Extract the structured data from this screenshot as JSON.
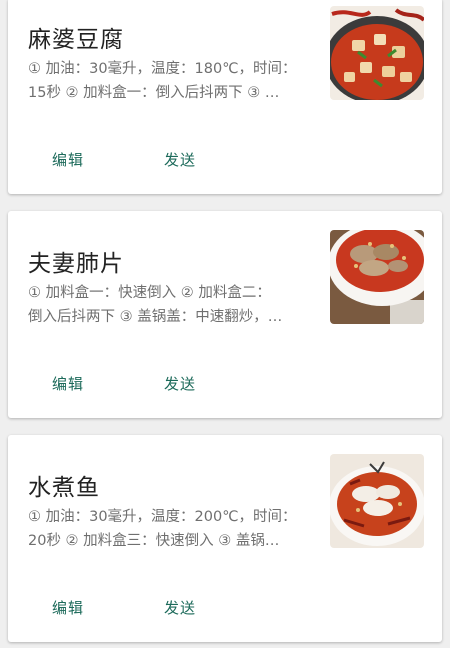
{
  "recipes": [
    {
      "title": "麻婆豆腐",
      "desc_line1": "① 加油：30毫升，温度：180℃，时间：",
      "desc_line2": "15秒 ② 加料盒一：倒入后抖两下 ③ …",
      "image": "mapo-tofu-photo",
      "edit_label": "编辑",
      "send_label": "发送"
    },
    {
      "title": "夫妻肺片",
      "desc_line1": "① 加料盒一：快速倒入 ② 加料盒二：",
      "desc_line2": "倒入后抖两下 ③ 盖锅盖：中速翻炒，…",
      "image": "fuqi-feipian-photo",
      "edit_label": "编辑",
      "send_label": "发送"
    },
    {
      "title": "水煮鱼",
      "desc_line1": "① 加油：30毫升，温度：200℃，时间：",
      "desc_line2": "20秒 ② 加料盒三：快速倒入 ③ 盖锅…",
      "image": "boiled-fish-photo",
      "edit_label": "编辑",
      "send_label": "发送"
    }
  ],
  "colors": {
    "accent": "#1c6a5a",
    "title": "#222222",
    "desc": "#6f6f6f",
    "background": "#efefef",
    "card": "#ffffff"
  }
}
